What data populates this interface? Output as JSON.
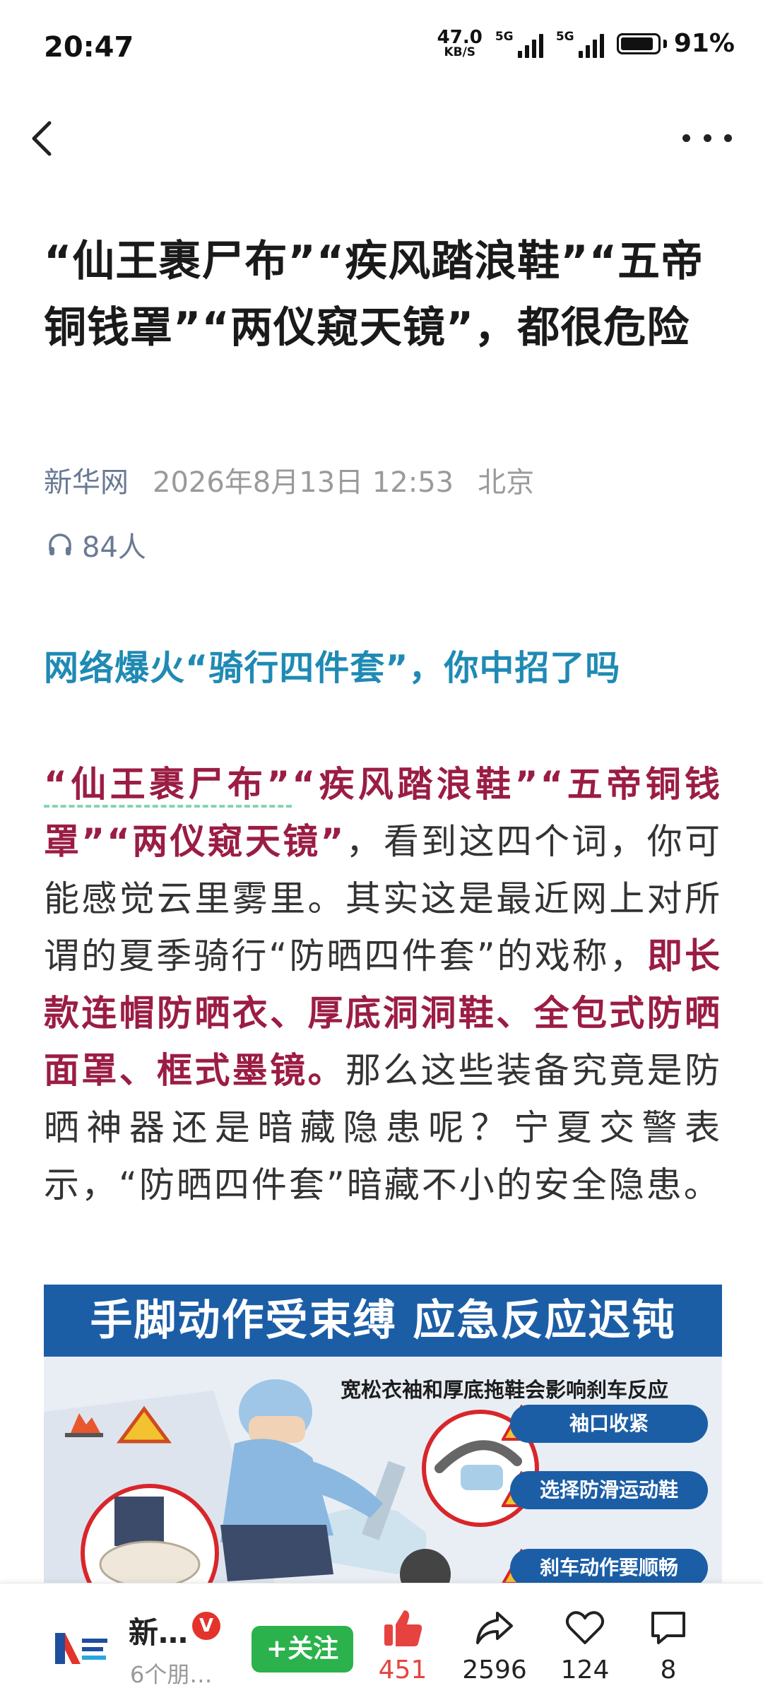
{
  "status_bar": {
    "time": "20:47",
    "net_speed_value": "47.0",
    "net_speed_unit": "KB/S",
    "signal_1_label": "5G",
    "signal_2_label": "5G",
    "battery_level": 0.91,
    "battery_text": "91%"
  },
  "nav": {
    "back_icon": "chevron-left-icon",
    "more_icon": "more-dots-icon"
  },
  "article": {
    "title": "“仙王裹尸布”“疾风踏浪鞋”“五帝铜钱罩”“两仪窥天镜”，都很危险",
    "source": "新华网",
    "date": "2026年8月13日 12:53",
    "location": "北京",
    "listeners": "84人",
    "subhead": "网络爆火“骑行四件套”，你中招了吗",
    "para": {
      "tag1": "“仙王裹尸布”",
      "rest_hl": "“疾风踏浪鞋”“五帝铜钱罩”“两仪窥天镜”",
      "text1": "，看到这四个词，你可能感觉云里雾里。其实这是最近网上对所谓的夏季骑行“防晒四件套”的戏称，",
      "hl2": "即长款连帽防晒衣、厚底洞洞鞋、全包式防晒面罩、框式墨镜。",
      "text2": "那么这些装备究竟是防晒神器还是暗藏隐患呢？宁夏交警表示，“防晒四件套”暗藏不小的安全隐患。"
    },
    "image": {
      "banner": "手脚动作受束缚  应急反应迟钝",
      "subtitle": "宽松衣袖和厚底拖鞋会影响刹车反应",
      "tips": [
        "袖口收紧",
        "选择防滑运动鞋",
        "刹车动作要顺畅"
      ]
    }
  },
  "bottom_bar": {
    "account_name": "新…",
    "verified_badge": "V",
    "account_sub": "6个朋…",
    "follow_label": "+关注",
    "like_count": "451",
    "share_count": "2596",
    "favorite_count": "124",
    "comment_count": "8",
    "accent_color": "#e64340",
    "follow_color": "#2bb24c"
  }
}
